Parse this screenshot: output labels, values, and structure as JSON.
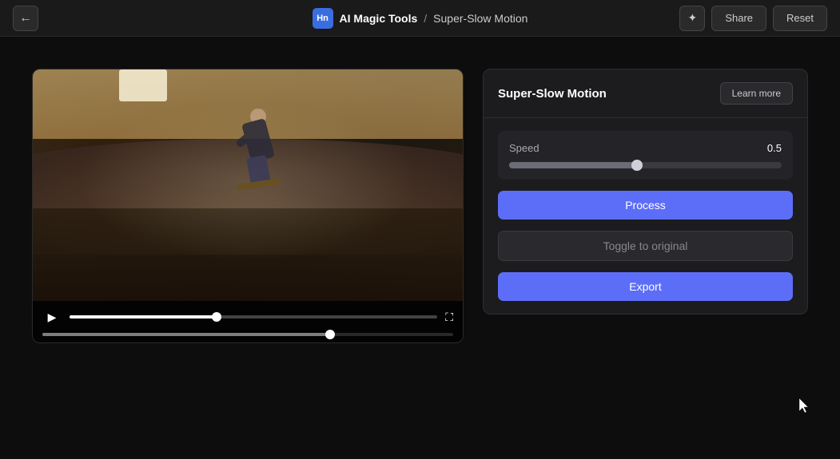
{
  "topbar": {
    "back_label": "←",
    "badge_text": "Hn",
    "title": "AI Magic Tools",
    "separator": "/",
    "subtitle": "Super-Slow Motion",
    "magic_icon": "✦",
    "share_label": "Share",
    "reset_label": "Reset"
  },
  "panel": {
    "title": "Super-Slow Motion",
    "learn_more_label": "Learn more",
    "speed_label": "Speed",
    "speed_value": "0.5",
    "speed_fill_pct": "47%",
    "process_label": "Process",
    "toggle_label": "Toggle to original",
    "export_label": "Export"
  },
  "video": {
    "progress_pct": "40%",
    "timeline_pct": "70%"
  }
}
